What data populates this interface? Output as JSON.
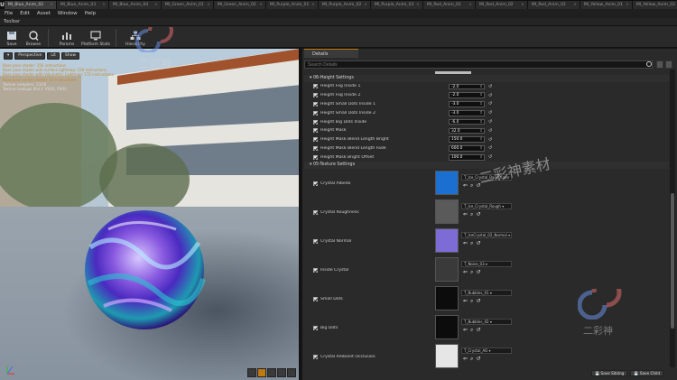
{
  "tabs": [
    "MI_Blue_Anim_02",
    "MI_Blue_Anim_03",
    "MI_Blue_Anim_04",
    "MI_Green_Anim_01",
    "MI_Green_Anim_02",
    "MI_Purple_Anim_01",
    "MI_Purple_Anim_02",
    "MI_Purple_Anim_03",
    "MI_Red_Anim_01",
    "MI_Red_Anim_02",
    "MI_Red_Anim_03",
    "MI_Yellow_Anim_01",
    "MI_Yellow_Anim_02"
  ],
  "menu": [
    "File",
    "Edit",
    "Asset",
    "Window",
    "Help"
  ],
  "toolbar_title": "Toolbar",
  "toolbar": {
    "save": "Save",
    "browse": "Browse",
    "params": "Params",
    "platform_stats": "Platform Stats",
    "hierarchy": "Hierarchy"
  },
  "viewport": {
    "perspective": "Perspective",
    "lit": "Lit",
    "show": "Show",
    "stats": [
      {
        "t": "Base pass shader: 156 instructions",
        "c": "r"
      },
      {
        "t": "Base pass shader with surface lightmap: 159 instructions",
        "c": "r"
      },
      {
        "t": "Base pass shader with Volumetric Lightmap: 172 instructions",
        "c": "r"
      },
      {
        "t": "Base pass vertex shader: 47 instructions",
        "c": "r"
      },
      {
        "t": "Texture samplers: 13/16",
        "c": "w"
      },
      {
        "t": "Texture Lookups (Est.): VS(0), PS(6)",
        "c": "w"
      }
    ]
  },
  "details": {
    "tab": "Details",
    "search_placeholder": "Search Details",
    "height_category": "06-Height Settings",
    "height_rows": [
      {
        "label": "Height Fog Inside 1",
        "value": "-2.0"
      },
      {
        "label": "Height Fog Inside 2",
        "value": "-2.0"
      },
      {
        "label": "Height Small Dots Inside 1",
        "value": "-3.0"
      },
      {
        "label": "Height Small Dots Inside 2",
        "value": "-3.0"
      },
      {
        "label": "Height Big Dots Inside",
        "value": "-6.0"
      },
      {
        "label": "Height Mask",
        "value": "32.0"
      },
      {
        "label": "Height Mask Blend Length Bright",
        "value": "150.0"
      },
      {
        "label": "Height Mask Blend Length Fade",
        "value": "600.0"
      },
      {
        "label": "Height Mask Bright Offset",
        "value": "100.0"
      }
    ],
    "texture_category": "05-Texture Settings",
    "texture_rows": [
      {
        "label": "Crystal Albedo",
        "asset": "T_Ice_Crystal_Base_Color",
        "color": "#1a6fd1"
      },
      {
        "label": "Crystal Roughness",
        "asset": "T_Ice_Crystal_Rough",
        "color": "#5a5a5a"
      },
      {
        "label": "Crystal Normal",
        "asset": "T_IceCrystal_02_Normal",
        "color": "#7d6bd6"
      },
      {
        "label": "Inside Crystal",
        "asset": "T_Noise_03",
        "color": "#3a3a3a"
      },
      {
        "label": "Small Dots",
        "asset": "T_Bubbles_01",
        "color": "#0c0c0c"
      },
      {
        "label": "Big Dots",
        "asset": "T_Bubbles_02",
        "color": "#0c0c0c"
      },
      {
        "label": "Crystal Ambient Occlusion",
        "asset": "T_Crystal_AO",
        "color": "#e6e6e6"
      }
    ]
  },
  "footer": {
    "save_sibling": "Save Sibling",
    "save_child": "Save Child"
  },
  "watermark": {
    "brand": "二彩神",
    "brand_full": "二彩神素材"
  }
}
